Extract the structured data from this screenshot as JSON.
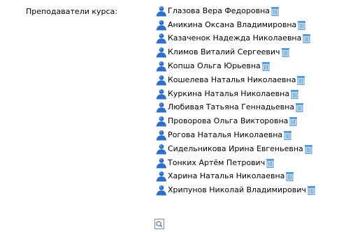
{
  "course_teachers": {
    "label": "Преподаватели курса:",
    "teachers": [
      {
        "name": "Глазова Вера Федоровна"
      },
      {
        "name": "Аникина Оксана Владимировна"
      },
      {
        "name": "Казаченок Надежда Николаевна"
      },
      {
        "name": "Климов Виталий Сергеевич"
      },
      {
        "name": "Копша Ольга Юрьевна"
      },
      {
        "name": "Кошелева Наталья Николаевна"
      },
      {
        "name": "Куркина Наталья Николаевна"
      },
      {
        "name": "Любивая Татьяна Геннадьевна"
      },
      {
        "name": "Проворова Ольга Викторовна"
      },
      {
        "name": "Рогова Наталья Николаевна"
      },
      {
        "name": "Сидельникова Ирина Евгеньевна"
      },
      {
        "name": "Тонких Артём Петрович"
      },
      {
        "name": "Харина Наталья Николаевна"
      },
      {
        "name": "Хрипунов Николай Владимирович"
      }
    ],
    "icons": {
      "teacher": "user-icon",
      "remove": "trash-icon",
      "add": "search-add-icon"
    },
    "colors": {
      "user_icon": "#2f6fc6",
      "remove_icon": "#5b9bd5",
      "text": "#000000"
    }
  }
}
